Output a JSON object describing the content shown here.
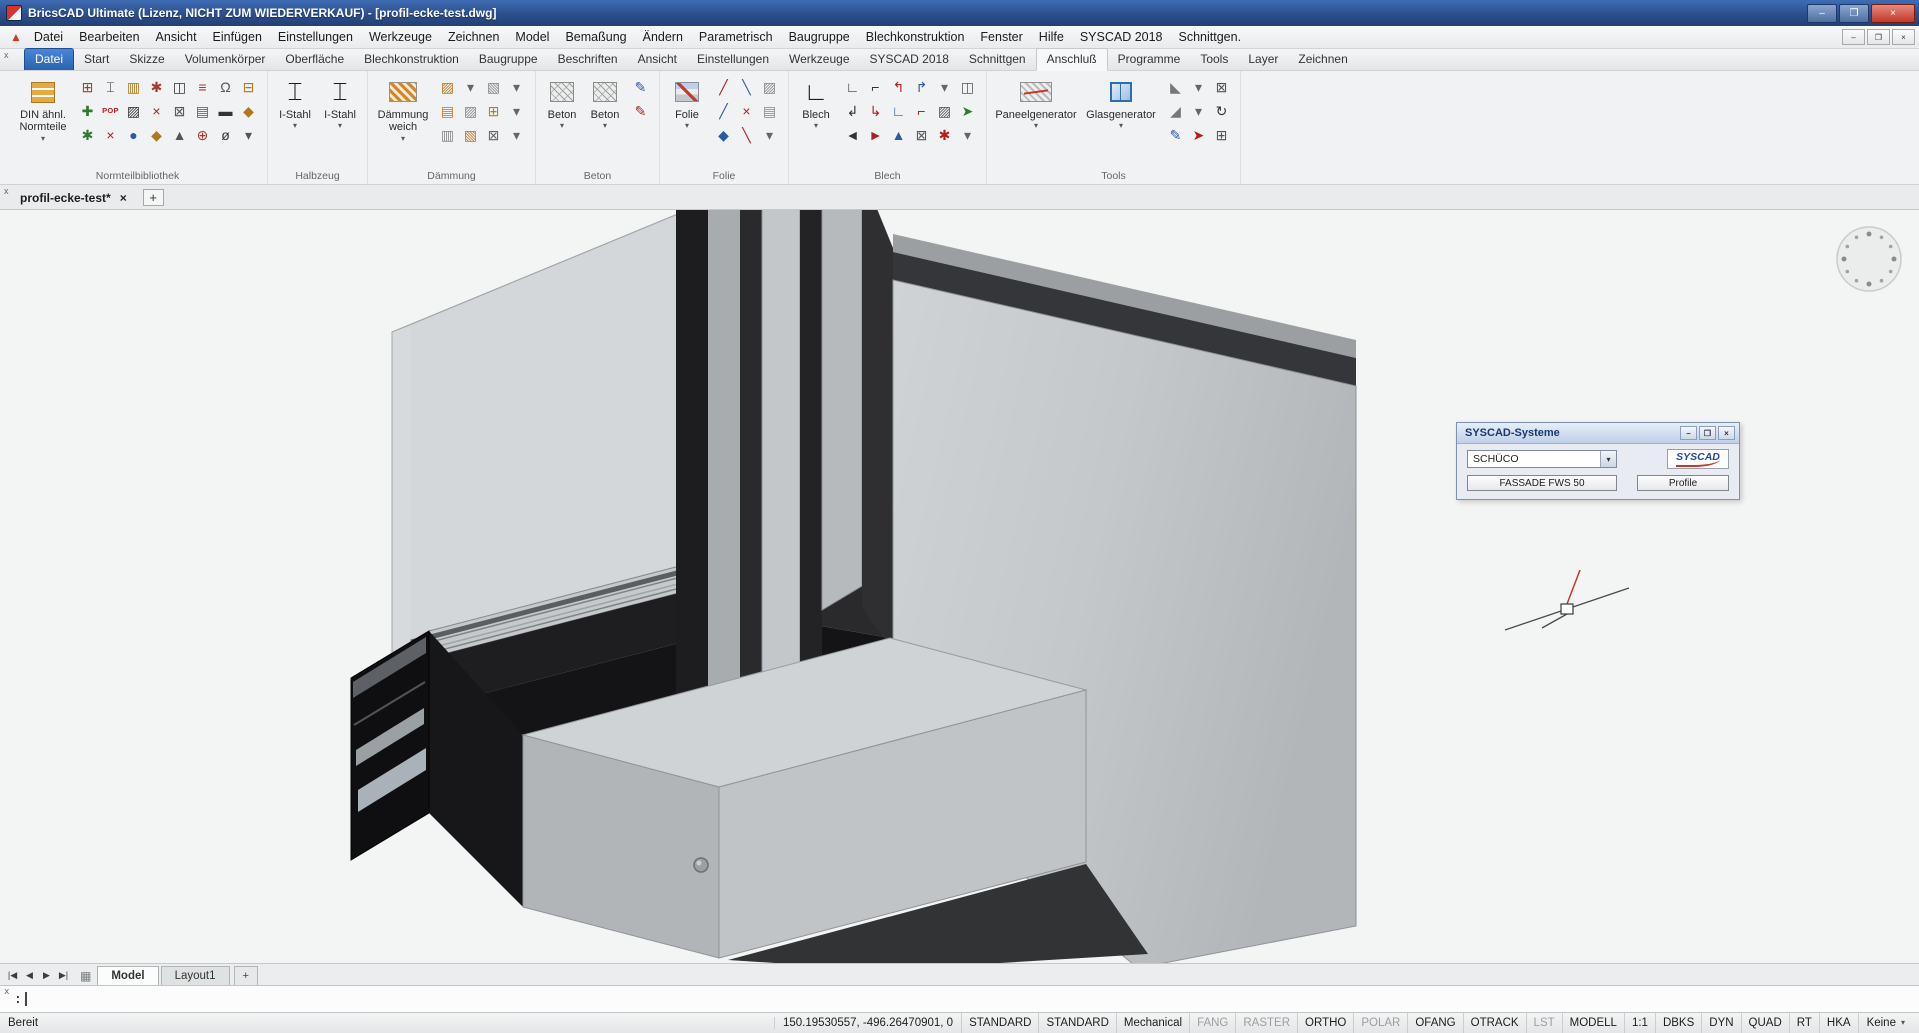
{
  "icons": {
    "minimize": "–",
    "restore": "❐",
    "maximize": "❐",
    "close": "×",
    "chevron_down": "▾",
    "plus": "+",
    "panel_close": "x",
    "sheet": "▦",
    "nav": [
      "|◀",
      "◀",
      "▶",
      "▶|"
    ]
  },
  "window": {
    "title": "BricsCAD Ultimate (Lizenz, NICHT ZUM WIEDERVERKAUF) - [profil-ecke-test.dwg]"
  },
  "menubar": {
    "items": [
      "Datei",
      "Bearbeiten",
      "Ansicht",
      "Einfügen",
      "Einstellungen",
      "Werkzeuge",
      "Zeichnen",
      "Model",
      "Bemaßung",
      "Ändern",
      "Parametrisch",
      "Baugruppe",
      "Blechkonstruktion",
      "Fenster",
      "Hilfe",
      "SYSCAD 2018",
      "Schnittgen."
    ]
  },
  "ribbon": {
    "tabs": [
      {
        "label": "Datei",
        "kind": "file"
      },
      {
        "label": "Start",
        "kind": "normal"
      },
      {
        "label": "Skizze",
        "kind": "normal"
      },
      {
        "label": "Volumenkörper",
        "kind": "normal"
      },
      {
        "label": "Oberfläche",
        "kind": "normal"
      },
      {
        "label": "Blechkonstruktion",
        "kind": "normal"
      },
      {
        "label": "Baugruppe",
        "kind": "normal"
      },
      {
        "label": "Beschriften",
        "kind": "normal"
      },
      {
        "label": "Ansicht",
        "kind": "normal"
      },
      {
        "label": "Einstellungen",
        "kind": "normal"
      },
      {
        "label": "Werkzeuge",
        "kind": "normal"
      },
      {
        "label": "SYSCAD 2018",
        "kind": "normal"
      },
      {
        "label": "Schnittgen",
        "kind": "normal"
      },
      {
        "label": "Anschluß",
        "kind": "active"
      },
      {
        "label": "Programme",
        "kind": "normal"
      },
      {
        "label": "Tools",
        "kind": "normal"
      },
      {
        "label": "Layer",
        "kind": "normal"
      },
      {
        "label": "Zeichnen",
        "kind": "normal"
      }
    ],
    "groups": [
      {
        "label": "Normteilbibliothek",
        "big_buttons": [
          {
            "label_lines": [
              "DIN ähnl.",
              "Normteile"
            ]
          }
        ],
        "icons": [
          {
            "g": "⊞",
            "c": "#a33c2e"
          },
          {
            "g": "⌶",
            "c": "#333333"
          },
          {
            "g": "▥",
            "c": "#b07818"
          },
          {
            "g": "✱",
            "c": "#a33c2e"
          },
          {
            "g": "◫",
            "c": "#333333"
          },
          {
            "g": "≡",
            "c": "#a33c2e"
          },
          {
            "g": "Ω",
            "c": "#555555"
          },
          {
            "g": "⊟",
            "c": "#b07818"
          },
          {
            "g": "✚",
            "c": "#2f7a2f"
          },
          {
            "g": "POP",
            "c": "#b02020",
            "small": true
          },
          {
            "g": "▨",
            "c": "#333333"
          },
          {
            "g": "×",
            "c": "#b02020"
          },
          {
            "g": "⊠",
            "c": "#555555"
          },
          {
            "g": "▤",
            "c": "#a33c2e"
          },
          {
            "g": "▬",
            "c": "#333333"
          },
          {
            "g": "◆",
            "c": "#b07818"
          },
          {
            "g": "✱",
            "c": "#2f7a2f"
          },
          {
            "g": "×",
            "c": "#b02020"
          },
          {
            "g": "●",
            "c": "#2b58a8"
          },
          {
            "g": "◆",
            "c": "#b07818"
          },
          {
            "g": "▲",
            "c": "#555555"
          },
          {
            "g": "⊕",
            "c": "#a33c2e"
          },
          {
            "g": "ø",
            "c": "#333333"
          },
          {
            "g": "▾",
            "c": "#555555"
          }
        ]
      },
      {
        "label": "Halbzeug",
        "big_buttons": [
          {
            "label_lines": [
              "I-Stahl"
            ],
            "glyph": "⌶"
          },
          {
            "label_lines": [
              "I-Stahl"
            ],
            "glyph": "⌶"
          }
        ],
        "icons": []
      },
      {
        "label": "Dämmung",
        "big_buttons": [
          {
            "label_lines": [
              "Dämmung",
              "weich"
            ]
          }
        ],
        "icons": [
          {
            "g": "▨",
            "c": "#c07820"
          },
          {
            "g": "▾",
            "c": "#666666"
          },
          {
            "g": "▧",
            "c": "#888888"
          },
          {
            "g": "▾",
            "c": "#666666"
          },
          {
            "g": "▤",
            "c": "#c07820"
          },
          {
            "g": "▨",
            "c": "#888888"
          },
          {
            "g": "⊞",
            "c": "#c07820"
          },
          {
            "g": "▾",
            "c": "#666666"
          },
          {
            "g": "▥",
            "c": "#888888"
          },
          {
            "g": "▧",
            "c": "#c07820"
          },
          {
            "g": "⊠",
            "c": "#666666"
          },
          {
            "g": "▾",
            "c": "#666666"
          }
        ]
      },
      {
        "label": "Beton",
        "big_buttons": [
          {
            "label_lines": [
              "Beton"
            ]
          },
          {
            "label_lines": [
              "Beton"
            ]
          }
        ],
        "icons": [
          {
            "g": "✎",
            "c": "#2b58a8"
          },
          {
            "g": "✎",
            "c": "#b02020"
          }
        ]
      },
      {
        "label": "Folie",
        "big_buttons": [
          {
            "label_lines": [
              "Folie"
            ]
          }
        ],
        "icons": [
          {
            "g": "╱",
            "c": "#b02020"
          },
          {
            "g": "╲",
            "c": "#2b58a8"
          },
          {
            "g": "▨",
            "c": "#888888"
          },
          {
            "g": "╱",
            "c": "#2b58a8"
          },
          {
            "g": "×",
            "c": "#b02020"
          },
          {
            "g": "▤",
            "c": "#888888"
          },
          {
            "g": "◆",
            "c": "#2b58a8"
          },
          {
            "g": "╲",
            "c": "#b02020"
          },
          {
            "g": "▾",
            "c": "#666666"
          }
        ]
      },
      {
        "label": "Blech",
        "big_buttons": [
          {
            "label_lines": [
              "Blech"
            ],
            "glyph": "∟"
          }
        ],
        "icons": [
          {
            "g": "∟",
            "c": "#333333"
          },
          {
            "g": "⌐",
            "c": "#333333"
          },
          {
            "g": "↰",
            "c": "#b02020"
          },
          {
            "g": "↱",
            "c": "#2b58a8"
          },
          {
            "g": "▾",
            "c": "#666666"
          },
          {
            "g": "◫",
            "c": "#555555"
          },
          {
            "g": "↲",
            "c": "#333333"
          },
          {
            "g": "↳",
            "c": "#b02020"
          },
          {
            "g": "∟",
            "c": "#2b58a8"
          },
          {
            "g": "⌐",
            "c": "#b02020"
          },
          {
            "g": "▨",
            "c": "#555555"
          },
          {
            "g": "➤",
            "c": "#2f7a2f"
          },
          {
            "g": "◄",
            "c": "#333333"
          },
          {
            "g": "►",
            "c": "#b02020"
          },
          {
            "g": "▲",
            "c": "#2b58a8"
          },
          {
            "g": "⊠",
            "c": "#555555"
          },
          {
            "g": "✱",
            "c": "#b02020"
          },
          {
            "g": "▾",
            "c": "#666666"
          }
        ]
      },
      {
        "label": "Tools",
        "big_buttons": [
          {
            "label_lines": [
              "Paneelgenerator"
            ]
          },
          {
            "label_lines": [
              "Glasgenerator"
            ]
          }
        ],
        "icons": [
          {
            "g": "◣",
            "c": "#777777"
          },
          {
            "g": "▾",
            "c": "#666666"
          },
          {
            "g": "⊠",
            "c": "#555555"
          },
          {
            "g": "◢",
            "c": "#777777"
          },
          {
            "g": "▾",
            "c": "#666666"
          },
          {
            "g": "↻",
            "c": "#333333"
          },
          {
            "g": "✎",
            "c": "#2b58a8"
          },
          {
            "g": "➤",
            "c": "#b02020"
          },
          {
            "g": "⊞",
            "c": "#555555"
          }
        ]
      }
    ]
  },
  "document_tabs": {
    "active": "profil-ecke-test*"
  },
  "palette": {
    "title": "SYSCAD-Systeme",
    "system_dropdown": {
      "value": "SCHÜCO"
    },
    "logo_text": "SYSCAD",
    "action_buttons": [
      {
        "label": "FASSADE FWS 50"
      },
      {
        "label": "Profile"
      }
    ]
  },
  "layout_tabs": {
    "tabs": [
      {
        "label": "Model",
        "active": true
      },
      {
        "label": "Layout1",
        "active": false
      }
    ]
  },
  "command_line": {
    "prompt": ":"
  },
  "status_bar": {
    "message": "Bereit",
    "coordinates": "150.19530557, -496.26470901, 0",
    "fields": [
      {
        "label": "STANDARD",
        "active": true
      },
      {
        "label": "STANDARD",
        "active": true
      },
      {
        "label": "Mechanical",
        "active": true
      },
      {
        "label": "FANG",
        "active": false
      },
      {
        "label": "RASTER",
        "active": false
      },
      {
        "label": "ORTHO",
        "active": true
      },
      {
        "label": "POLAR",
        "active": false
      },
      {
        "label": "OFANG",
        "active": true
      },
      {
        "label": "OTRACK",
        "active": true
      },
      {
        "label": "LST",
        "active": false
      },
      {
        "label": "MODELL",
        "active": true
      },
      {
        "label": "1:1",
        "active": true
      },
      {
        "label": "DBKS",
        "active": true
      },
      {
        "label": "DYN",
        "active": true
      },
      {
        "label": "QUAD",
        "active": true
      },
      {
        "label": "RT",
        "active": true
      },
      {
        "label": "HKA",
        "active": true
      }
    ],
    "dropdown_value": "Keine"
  },
  "colors": {
    "titlebar_blue": "#2c4f8c",
    "file_tab_blue": "#2a62b0",
    "close_red": "#c0392b",
    "profile_dark": "#17171a",
    "aluminium_gray": "#c1c4c7"
  }
}
